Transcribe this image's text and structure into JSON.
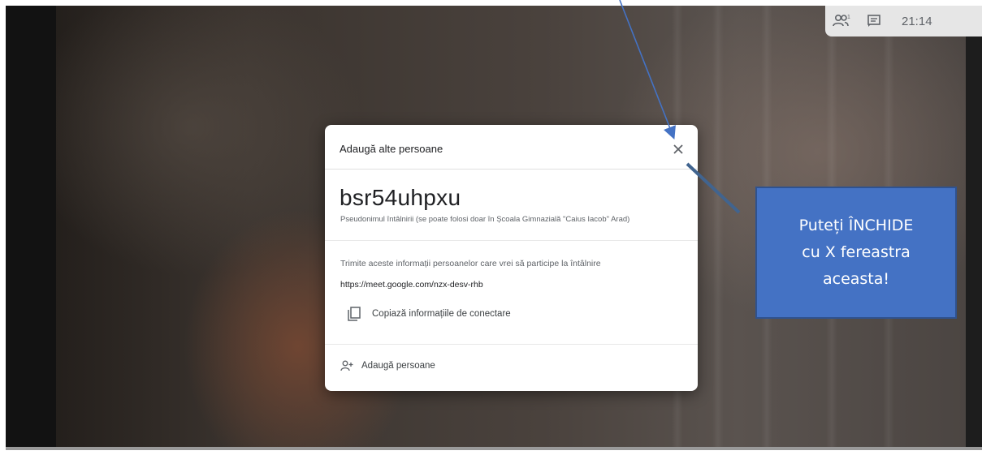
{
  "topbar": {
    "people_icon": "people-icon",
    "chat_icon": "chat-icon",
    "time": "21:14"
  },
  "dialog": {
    "title": "Adaugă alte persoane",
    "close_icon": "close-icon",
    "meeting_code": "bsr54uhpxu",
    "alias_note": "Pseudonimul întâlnirii (se poate folosi doar în Școala Gimnazială \"Caius Iacob\" Arad)",
    "send_info": "Trimite aceste informații persoanelor care vrei să participe la întâlnire",
    "meeting_link": "https://meet.google.com/nzx-desv-rhb",
    "copy_label": "Copiază informațiile de conectare",
    "copy_icon": "copy-icon",
    "add_people_label": "Adaugă persoane",
    "add_people_icon": "add-person-icon"
  },
  "callout": {
    "lines": [
      "Puteți ÎNCHIDE",
      "cu X fereastra",
      "aceasta!"
    ]
  },
  "colors": {
    "callout_fill": "#4472c4",
    "callout_border": "#2f528f",
    "arrow": "#4472c4"
  }
}
